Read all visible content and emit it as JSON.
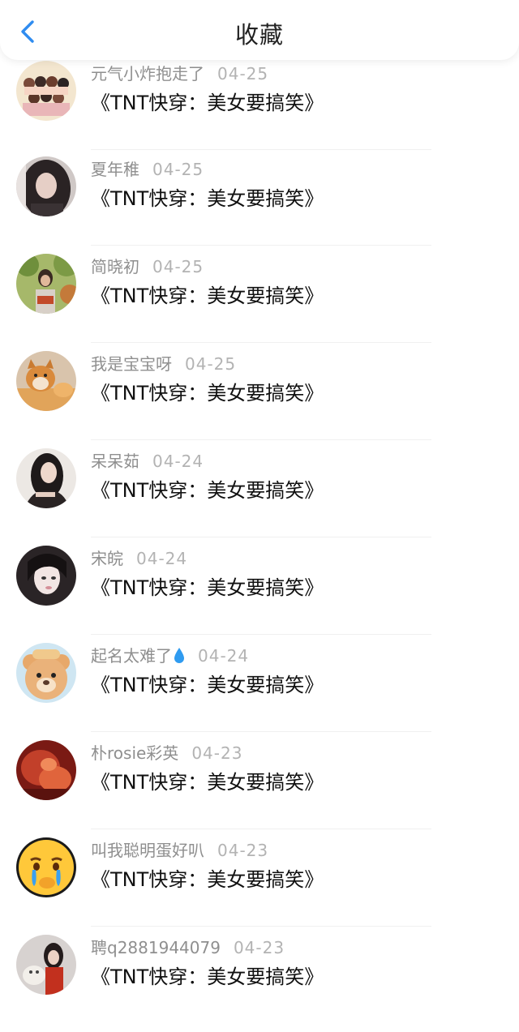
{
  "header": {
    "title": "收藏"
  },
  "items": [
    {
      "username": "元气小炸抱走了",
      "date": "04-25",
      "content": "《TNT快穿：美女要搞笑》",
      "avatar": "cartoon-group-avatar"
    },
    {
      "username": "夏年稚",
      "date": "04-25",
      "content": "《TNT快穿：美女要搞笑》",
      "avatar": "girl-dark-hair-avatar"
    },
    {
      "username": "简晓初",
      "date": "04-25",
      "content": "《TNT快穿：美女要搞笑》",
      "avatar": "person-outdoor-avatar"
    },
    {
      "username": "我是宝宝呀",
      "date": "04-25",
      "content": "《TNT快穿：美女要搞笑》",
      "avatar": "shiba-dog-avatar"
    },
    {
      "username": "呆呆茹",
      "date": "04-24",
      "content": "《TNT快穿：美女要搞笑》",
      "avatar": "girl-long-hair-avatar"
    },
    {
      "username": "宋皖",
      "date": "04-24",
      "content": "《TNT快穿：美女要搞笑》",
      "avatar": "girl-pale-avatar"
    },
    {
      "username": "起名太难了",
      "date": "04-24",
      "content": "《TNT快穿：美女要搞笑》",
      "avatar": "bear-cartoon-avatar",
      "has_drop_emoji": true
    },
    {
      "username": "朴rosie彩英",
      "date": "04-23",
      "content": "《TNT快穿：美女要搞笑》",
      "avatar": "red-photo-avatar"
    },
    {
      "username": "叫我聪明蛋好叭",
      "date": "04-23",
      "content": "《TNT快穿：美女要搞笑》",
      "avatar": "crying-emoji-avatar"
    },
    {
      "username": "聘q2881944079",
      "date": "04-23",
      "content": "《TNT快穿：美女要搞笑》",
      "avatar": "girl-with-cat-avatar"
    }
  ],
  "colors": {
    "accent": "#2f8cf0",
    "title": "#222222",
    "username": "#8f8f8f",
    "date": "#b3b3b3",
    "content": "#111111"
  }
}
